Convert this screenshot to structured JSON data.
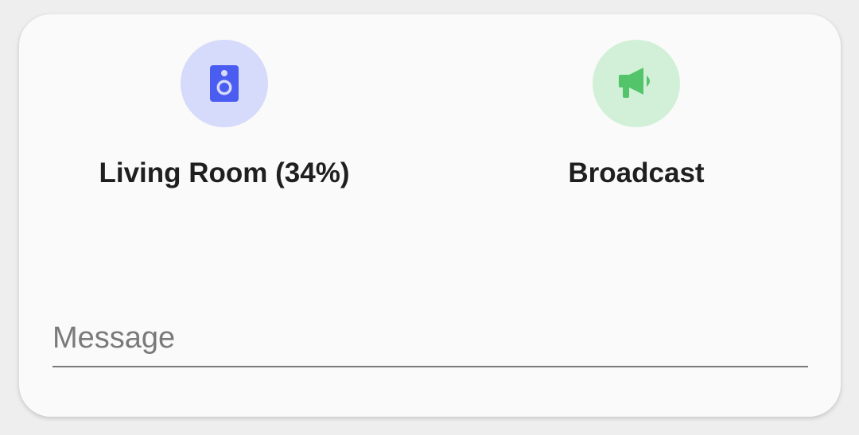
{
  "tiles": [
    {
      "label": "Living Room (34%)",
      "icon": "speaker-icon",
      "circle_color": "#d6dafb",
      "icon_color": "#4a5df0"
    },
    {
      "label": "Broadcast",
      "icon": "megaphone-icon",
      "circle_color": "#d2f0d8",
      "icon_color": "#54c46a"
    }
  ],
  "message": {
    "placeholder": "Message",
    "value": ""
  }
}
